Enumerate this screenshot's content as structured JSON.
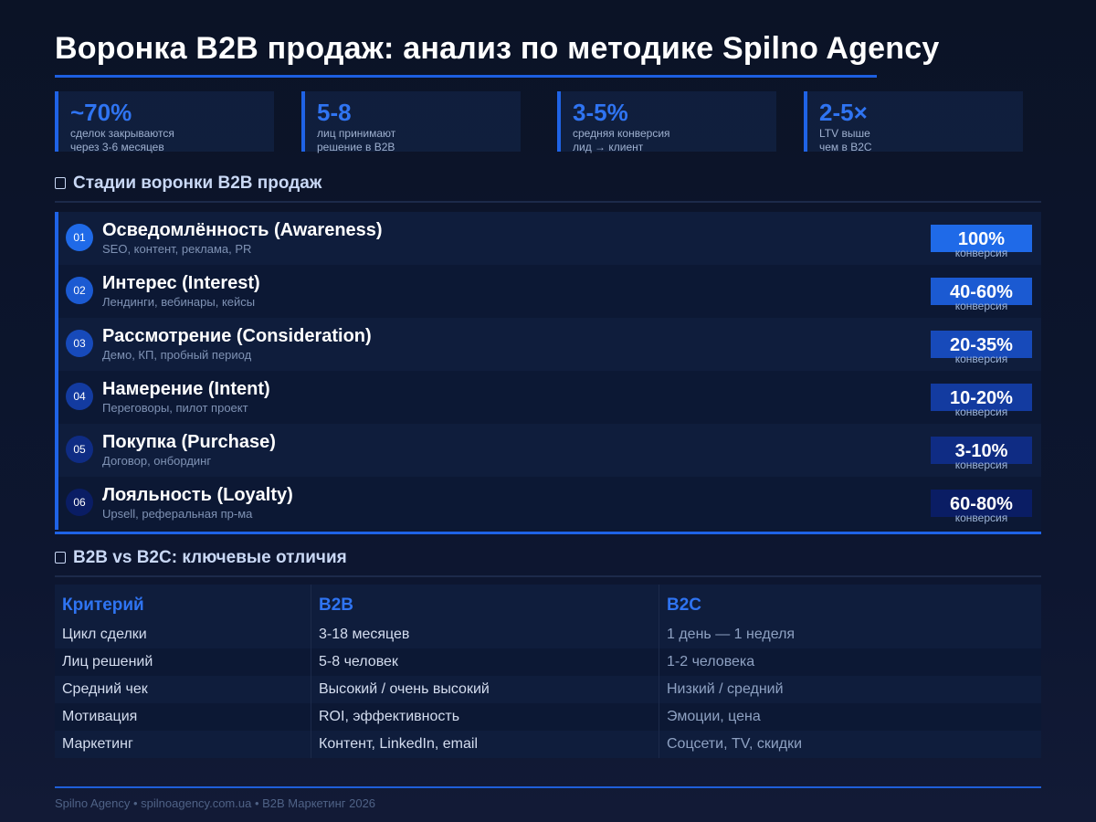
{
  "title": "Воронка B2B продаж: анализ по методике Spilno Agency",
  "stats": [
    {
      "value": "~70%",
      "desc": "сделок закрываются\nчерез 3-6 месяцев"
    },
    {
      "value": "5-8",
      "desc": "лиц принимают\nрешение в B2B"
    },
    {
      "value": "3-5%",
      "desc": "средняя конверсия\nлид → клиент"
    },
    {
      "value": "2-5×",
      "desc": "LTV выше\nчем в B2C"
    }
  ],
  "funnel": {
    "heading": "Стадии воронки B2B продаж",
    "conversion_label": "конверсия",
    "stages": [
      {
        "num": "01",
        "name": "Осведомлённость (Awareness)",
        "sub": "SEO, контент, реклама, PR",
        "conv": "100%",
        "color": "#1f6ae8"
      },
      {
        "num": "02",
        "name": "Интерес (Interest)",
        "sub": "Лендинги, вебинары, кейсы",
        "conv": "40-60%",
        "color": "#1b5ad2"
      },
      {
        "num": "03",
        "name": "Рассмотрение (Consideration)",
        "sub": "Демо, КП, пробный период",
        "conv": "20-35%",
        "color": "#174aba"
      },
      {
        "num": "04",
        "name": "Намерение (Intent)",
        "sub": "Переговоры, пилот проект",
        "conv": "10-20%",
        "color": "#133ba0"
      },
      {
        "num": "05",
        "name": "Покупка (Purchase)",
        "sub": "Договор, онбординг",
        "conv": "3-10%",
        "color": "#0f2c84"
      },
      {
        "num": "06",
        "name": "Лояльность (Loyalty)",
        "sub": "Upsell, реферальная пр-ма",
        "conv": "60-80%",
        "color": "#0a1d64"
      }
    ]
  },
  "comparison": {
    "heading": "B2B vs B2C: ключевые отличия",
    "headers": [
      "Критерий",
      "B2B",
      "B2C"
    ],
    "rows": [
      [
        "Цикл сделки",
        "3-18 месяцев",
        "1 день — 1 неделя"
      ],
      [
        "Лиц решений",
        "5-8 человек",
        "1-2 человека"
      ],
      [
        "Средний чек",
        "Высокий / очень высокий",
        "Низкий / средний"
      ],
      [
        "Мотивация",
        "ROI, эффективность",
        "Эмоции, цена"
      ],
      [
        "Маркетинг",
        "Контент, LinkedIn, email",
        "Соцсети, TV, скидки"
      ]
    ]
  },
  "footer": "Spilno Agency • spilnoagency.com.ua • B2B Маркетинг 2026"
}
